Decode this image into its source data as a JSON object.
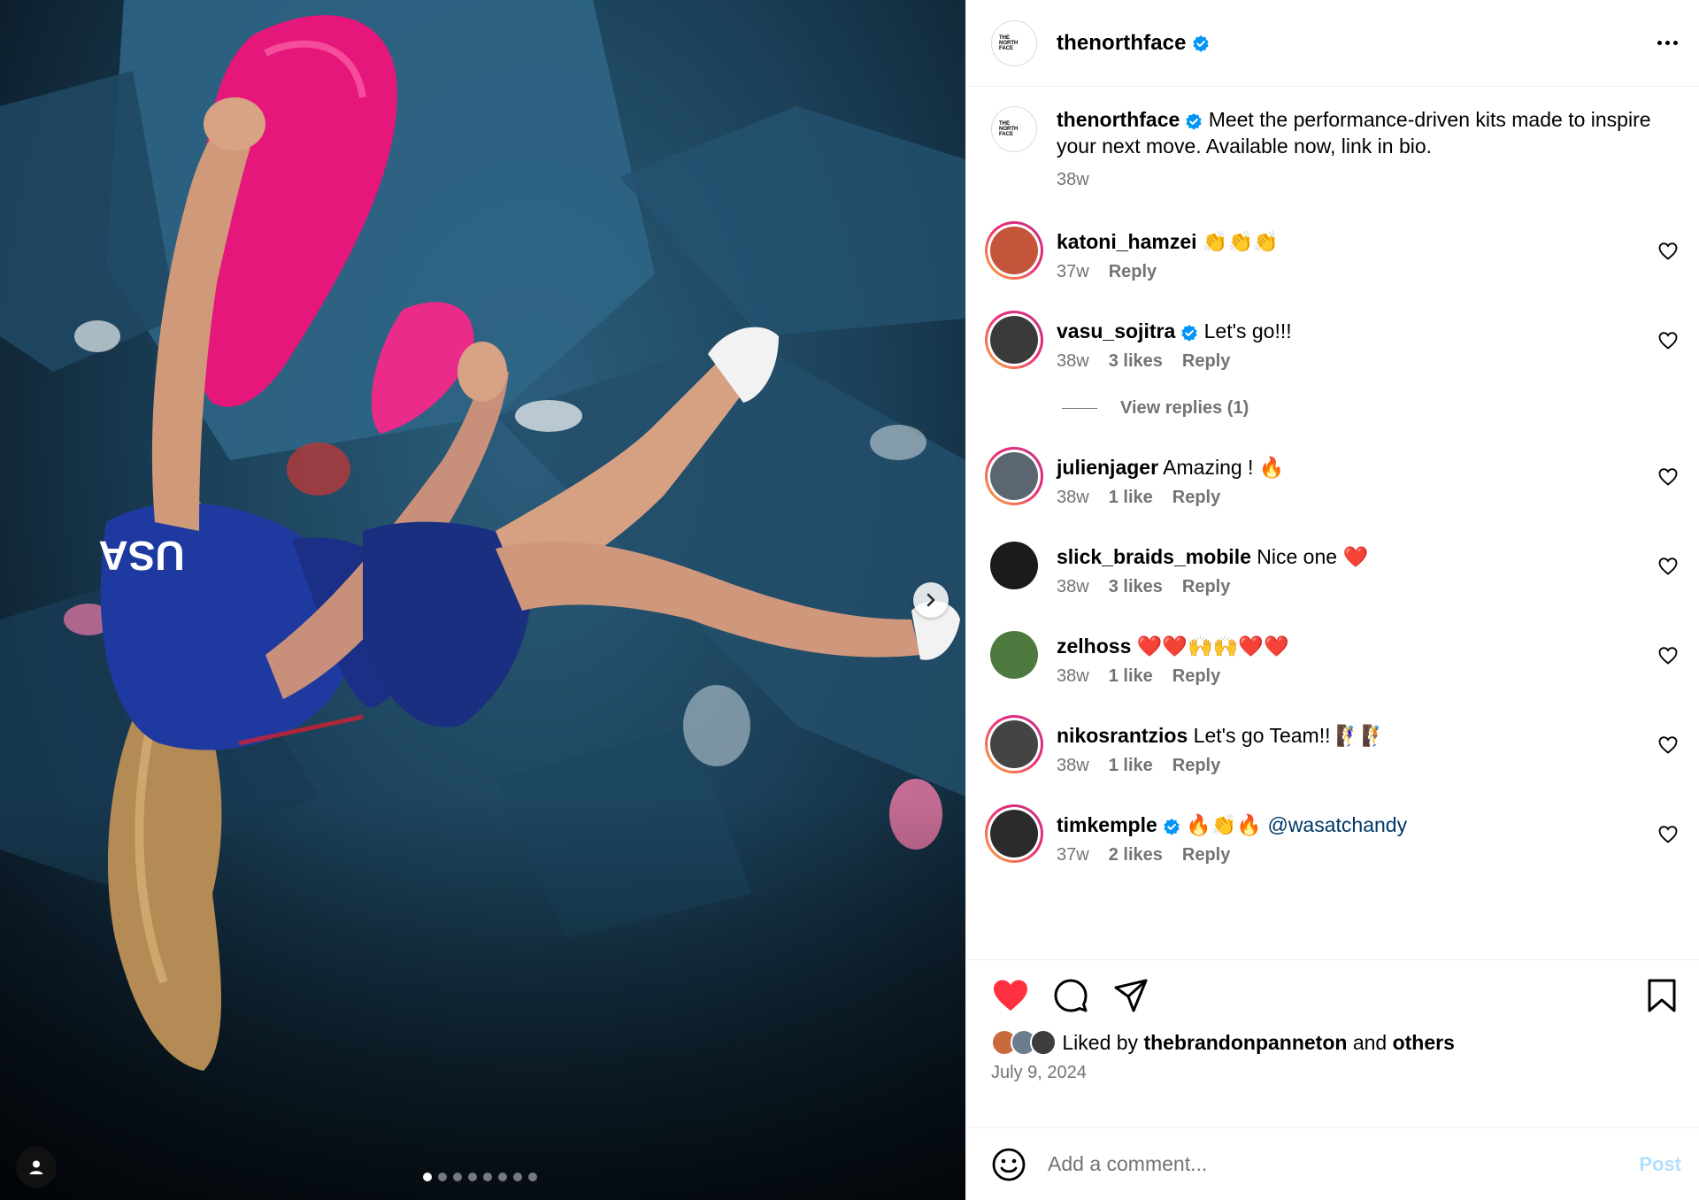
{
  "post": {
    "author": "thenorthface",
    "logo_text": [
      "THE",
      "NORTH",
      "FACE"
    ],
    "caption": "Meet the performance-driven kits made to inspire your next move. Available now, link in bio.",
    "caption_age": "38w",
    "jersey_text": "USA",
    "carousel_count": 8,
    "carousel_active": 0
  },
  "comments": [
    {
      "user": "katoni_hamzei",
      "text": "👏👏👏",
      "verified": false,
      "age": "37w",
      "likes": "",
      "reply": "Reply"
    },
    {
      "user": "vasu_sojitra",
      "text": "Let's go!!!",
      "verified": true,
      "age": "38w",
      "likes": "3 likes",
      "reply": "Reply"
    },
    {
      "user": "julienjager",
      "text": "Amazing ! 🔥",
      "verified": false,
      "age": "38w",
      "likes": "1 like",
      "reply": "Reply"
    },
    {
      "user": "slick_braids_mobile",
      "text": "Nice one ❤️",
      "verified": false,
      "age": "38w",
      "likes": "3 likes",
      "reply": "Reply"
    },
    {
      "user": "zelhoss",
      "text": "❤️❤️🙌🙌❤️❤️",
      "verified": false,
      "age": "38w",
      "likes": "1 like",
      "reply": "Reply"
    },
    {
      "user": "nikosrantzios",
      "text": "Let's go Team!! 🧗‍♀️🧗",
      "verified": false,
      "age": "38w",
      "likes": "1 like",
      "reply": "Reply"
    },
    {
      "user": "timkemple",
      "text": "🔥👏🔥",
      "mention": "@wasatchandy",
      "verified": true,
      "age": "37w",
      "likes": "2 likes",
      "reply": "Reply"
    }
  ],
  "view_replies": "View replies (1)",
  "liked_by": {
    "prefix": "Liked by",
    "user": "thebrandonpanneton",
    "and": "and",
    "others": "others"
  },
  "date": "July 9, 2024",
  "add_comment": {
    "placeholder": "Add a comment...",
    "post_label": "Post"
  },
  "icons": {
    "header": [
      "more-options-icon"
    ],
    "actions": [
      "heart-icon",
      "comment-icon",
      "share-icon",
      "bookmark-icon"
    ],
    "media": [
      "chevron-right-icon",
      "user-tag-icon"
    ],
    "input": [
      "emoji-icon"
    ]
  },
  "colors": {
    "liked_heart": "#ff3040",
    "verified": "#0095f6",
    "secondary_text": "#737373",
    "post_disabled": "#b2dffc",
    "mention": "#00376b"
  }
}
